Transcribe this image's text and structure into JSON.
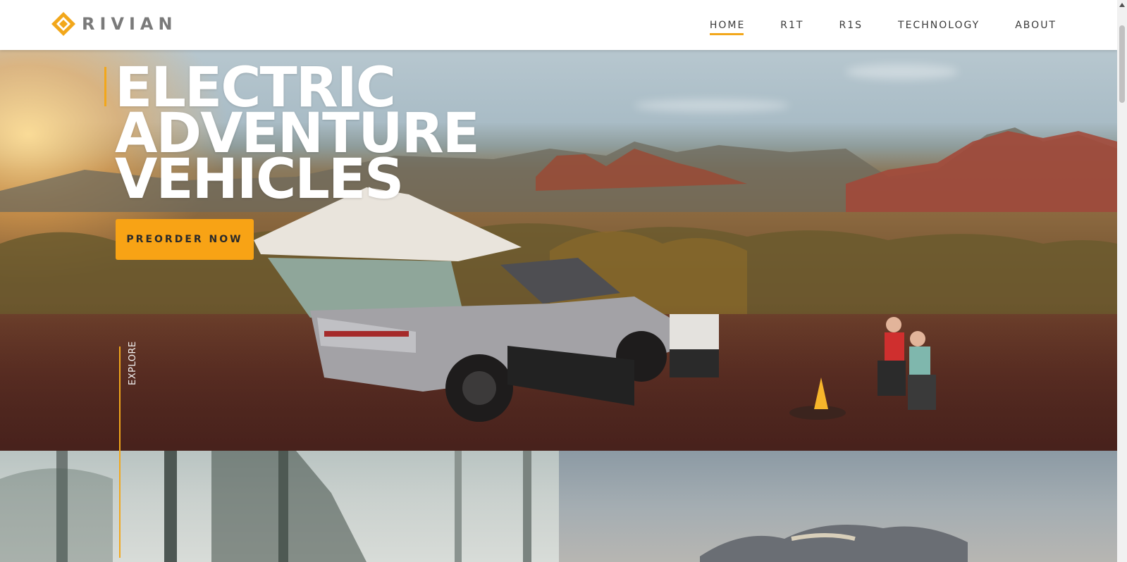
{
  "brand": {
    "name": "RIVIAN",
    "accent_color": "#f2a71b",
    "logo_icon": "rivian-compass-logo-icon"
  },
  "nav": {
    "items": [
      {
        "label": "HOME",
        "active": true
      },
      {
        "label": "R1T",
        "active": false
      },
      {
        "label": "R1S",
        "active": false
      },
      {
        "label": "TECHNOLOGY",
        "active": false
      },
      {
        "label": "ABOUT",
        "active": false
      }
    ]
  },
  "hero": {
    "title_lines": [
      "ELECTRIC",
      "ADVENTURE",
      "VEHICLES"
    ],
    "cta_label": "PREORDER NOW",
    "cta_color": "#f8a315"
  },
  "explore": {
    "label": "EXPLORE"
  }
}
